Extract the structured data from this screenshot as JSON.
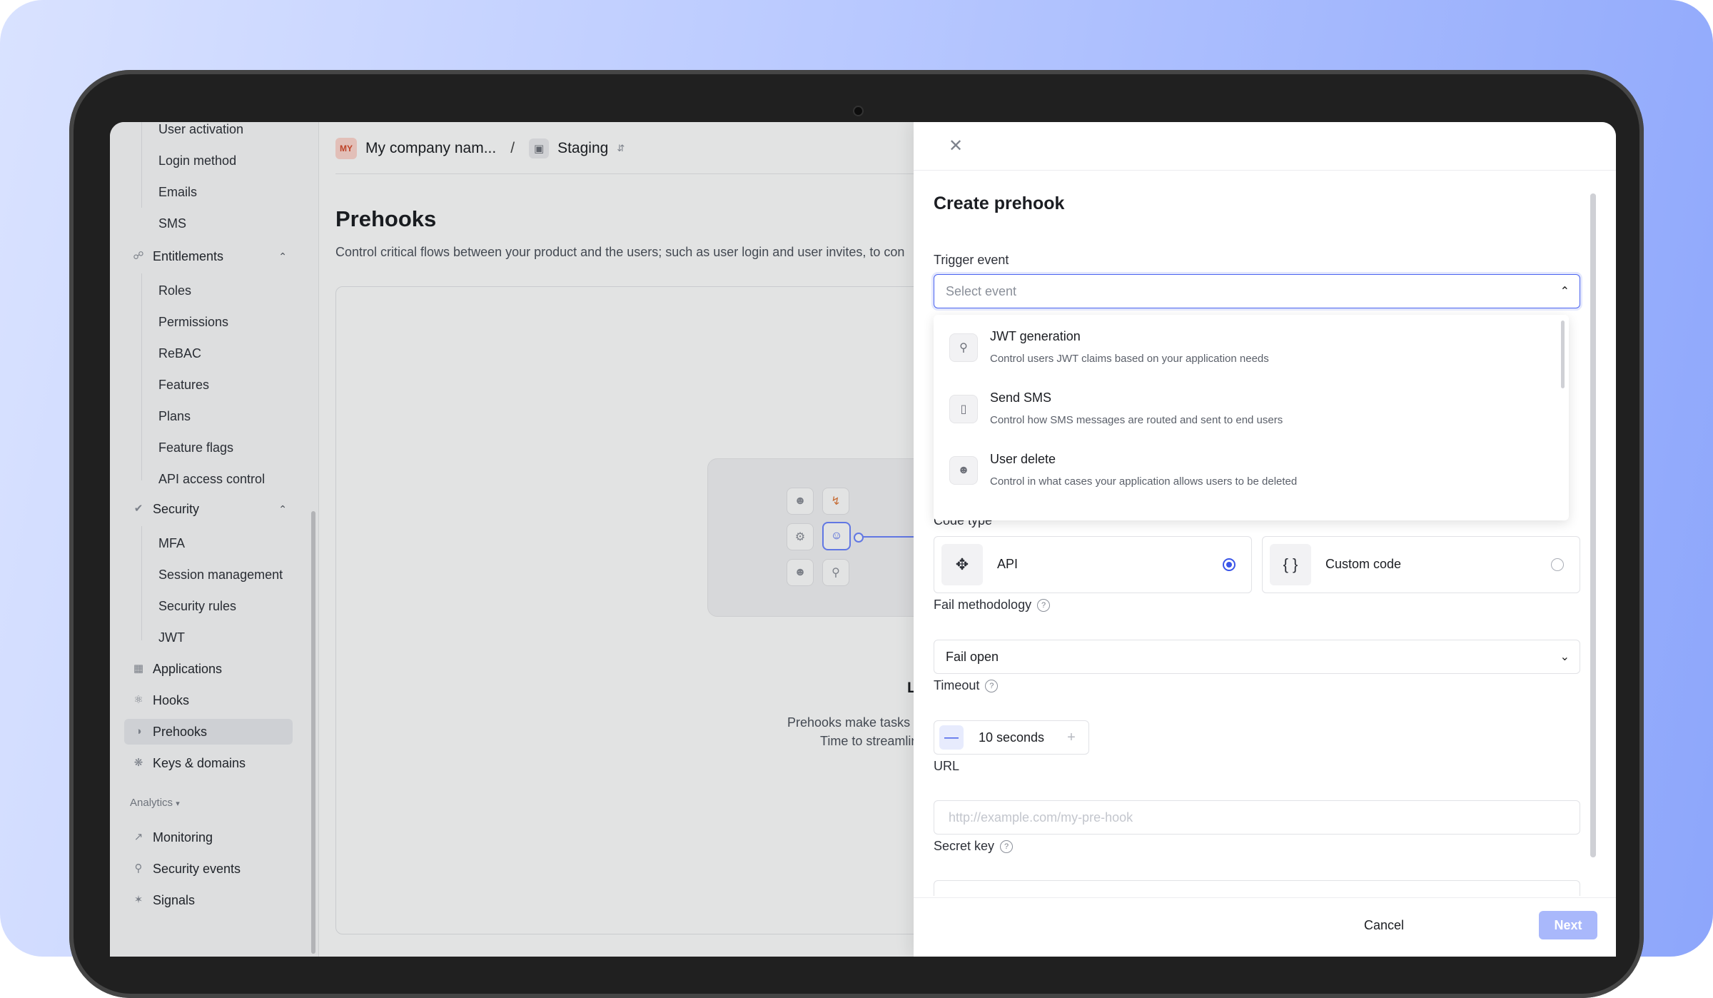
{
  "sidebar": {
    "sub_items_top": [
      "User activation",
      "Login method",
      "Emails",
      "SMS"
    ],
    "entitlements": {
      "label": "Entitlements",
      "items": [
        "Roles",
        "Permissions",
        "ReBAC",
        "Features",
        "Plans",
        "Feature flags",
        "API access control"
      ]
    },
    "security": {
      "label": "Security",
      "items": [
        "MFA",
        "Session management",
        "Security rules",
        "JWT"
      ]
    },
    "top_items": [
      "Applications",
      "Hooks",
      "Prehooks",
      "Keys & domains"
    ],
    "active_item": "Prehooks",
    "analytics": {
      "label": "Analytics",
      "items": [
        "Monitoring",
        "Security events",
        "Signals"
      ]
    }
  },
  "header": {
    "company_badge": "MY",
    "company": "My company nam...",
    "separator": "/",
    "environment": "Staging"
  },
  "main": {
    "title": "Prehooks",
    "description": "Control critical flows between your product and the users; such as user login and user invites, to con",
    "empty_state": {
      "title": "Let",
      "line1": "Prehooks make tasks smo",
      "line2": "Time to streamlini"
    }
  },
  "drawer": {
    "title": "Create prehook",
    "trigger_event": {
      "label": "Trigger event",
      "placeholder": "Select event",
      "options": [
        {
          "icon": "key-icon",
          "title": "JWT generation",
          "description": "Control users JWT claims based on your application needs"
        },
        {
          "icon": "phone-icon",
          "title": "Send SMS",
          "description": "Control how SMS messages are routed and sent to end users"
        },
        {
          "icon": "user-remove-icon",
          "title": "User delete",
          "description": "Control in what cases your application allows users to be deleted"
        }
      ]
    },
    "code_type": {
      "label": "Code type",
      "options": [
        {
          "label": "API",
          "selected": true
        },
        {
          "label": "Custom code",
          "selected": false
        }
      ]
    },
    "fail_methodology": {
      "label": "Fail methodology",
      "value": "Fail open"
    },
    "timeout": {
      "label": "Timeout",
      "value": "10 seconds"
    },
    "url": {
      "label": "URL",
      "placeholder": "http://example.com/my-pre-hook"
    },
    "secret_key": {
      "label": "Secret key"
    },
    "cancel_label": "Cancel",
    "next_label": "Next"
  },
  "colors": {
    "accent": "#3a55e8",
    "next_disabled": "#a9b8fb"
  }
}
